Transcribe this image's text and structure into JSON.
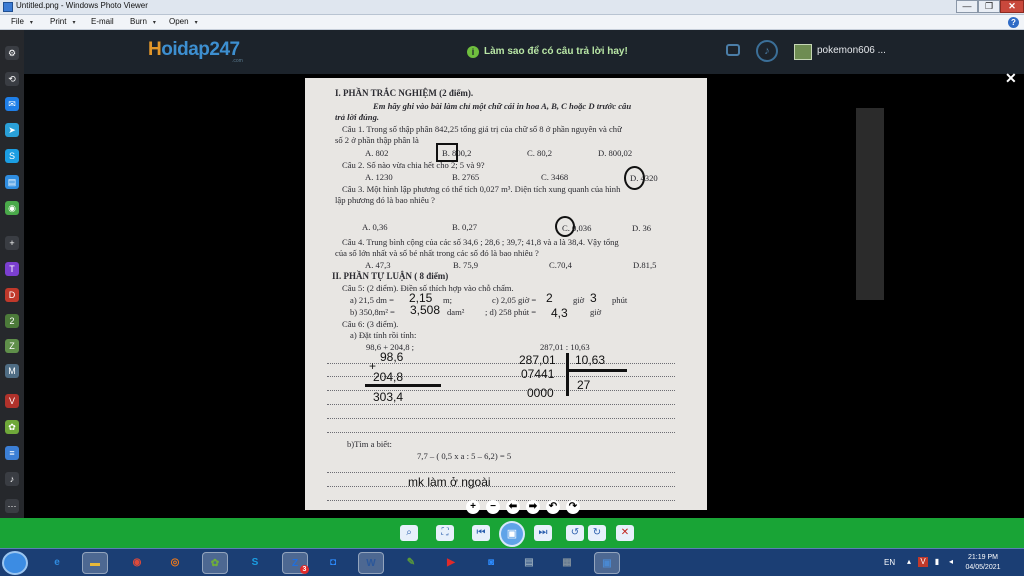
{
  "window": {
    "title": "Untitled.png - Windows Photo Viewer",
    "minimize": "—",
    "maximize": "❐",
    "close": "✕"
  },
  "menu": {
    "items": [
      {
        "label": "File",
        "arrow": "▾"
      },
      {
        "label": "Print",
        "arrow": "▾"
      },
      {
        "label": "E-mail",
        "arrow": ""
      },
      {
        "label": "Burn",
        "arrow": "▾"
      },
      {
        "label": "Open",
        "arrow": "▾"
      }
    ],
    "help": "?"
  },
  "site": {
    "logo_h": "H",
    "logo_rest": "oidap247",
    "logo_sub": ".com",
    "howto": "Làm sao để có câu trả lời hay!",
    "username": "pokemon606 ...",
    "close_overlay": "✕"
  },
  "sidebar": {
    "icons": [
      {
        "name": "settings",
        "glyph": "⚙",
        "color": "#3a3d43"
      },
      {
        "name": "history",
        "glyph": "⟲",
        "color": "#3a3d43"
      },
      {
        "name": "messenger",
        "glyph": "✉",
        "color": "#1f7fe8"
      },
      {
        "name": "telegram",
        "glyph": "➤",
        "color": "#2aa0d8"
      },
      {
        "name": "skype",
        "glyph": "S",
        "color": "#1b9ee3"
      },
      {
        "name": "chat",
        "glyph": "▤",
        "color": "#2f8de0"
      },
      {
        "name": "games",
        "glyph": "◉",
        "color": "#4aa94a"
      },
      {
        "name": "add",
        "glyph": "+",
        "color": "#3a3d43"
      },
      {
        "name": "twitch",
        "glyph": "T",
        "color": "#7b3fd0"
      },
      {
        "name": "d-app",
        "glyph": "D",
        "color": "#c0392b"
      },
      {
        "name": "two",
        "glyph": "2",
        "color": "#4c7a3a"
      },
      {
        "name": "z-app",
        "glyph": "Z",
        "color": "#5f8f4a"
      },
      {
        "name": "m-app",
        "glyph": "M",
        "color": "#4f6d84"
      },
      {
        "name": "vnexpress",
        "glyph": "V",
        "color": "#b0322b"
      },
      {
        "name": "leaf",
        "glyph": "✿",
        "color": "#6fa83a"
      },
      {
        "name": "news",
        "glyph": "≡",
        "color": "#3c7fd5"
      },
      {
        "name": "bell",
        "glyph": "♪",
        "color": "#3a3d43"
      },
      {
        "name": "more",
        "glyph": "⋯",
        "color": "#3a3d43"
      }
    ]
  },
  "photo": {
    "section1_title": "I. PHẦN TRẮC NGHIỆM (2 điểm).",
    "instruction_1": "Em hãy ghi vào bài làm chỉ một chữ cái in hoa A, B, C hoặc D trước câu",
    "instruction_2": "trả lời đúng.",
    "q1_1": "Câu 1. Trong số thập phân 842,25 tổng giá trị của chữ số 8 ở phần nguyên và chữ",
    "q1_2": "số 2 ở phần thập phân là",
    "q1_a": "A. 802",
    "q1_b": "B. 800,2",
    "q1_c": "C.  80,2",
    "q1_d": "D. 800,02",
    "q2": "Câu 2. Số nào vừa chia hết cho 2; 5 và 9?",
    "q2_a": "A. 1230",
    "q2_b": "B. 2765",
    "q2_c": "C. 3468",
    "q2_d": "D. 4320",
    "q3_1": "Câu 3. Một hình lập phương có thể tích 0,027 m³. Diện tích xung quanh của hình",
    "q3_2": "lập phương đó là bao nhiêu ?",
    "q3_a": "A.   0,36",
    "q3_b": "B.     0,27",
    "q3_c": "C. 0,036",
    "q3_d": "D. 36",
    "q4_1": "Câu 4. Trung bình cộng của các số 34,6 ; 28,6 ; 39,7; 41,8 và a là 38,4. Vậy tổng",
    "q4_2": "của số lớn nhất và số bé nhất trong các số đó  là bao nhiêu ?",
    "q4_a": "A. 47,3",
    "q4_b": "B. 75,9",
    "q4_c": "C.70,4",
    "q4_d": "D.81,5",
    "section2_title": "II. PHẦN TỰ LUẬN ( 8 điểm)",
    "q5": "Câu 5: (2 điểm).  Điền số thích hợp vào chỗ chấm.",
    "q5_a": "a) 21,5 dm =",
    "q5_a_unit": "m;",
    "q5_c": "c) 2,05 giờ =",
    "q5_c_unit": "giờ",
    "q5_c_unit2": "phút",
    "q5_b": "b) 350,8m² =",
    "q5_b_unit": "dam²",
    "q5_d": "; d) 258 phút =",
    "q5_d_unit": "giờ",
    "q6": "Câu 6: (3 điểm).",
    "q6_a": "a) Đặt tính rồi tính:",
    "q6_a1": "98,6 + 204,8  ;",
    "q6_a2": "287,01 : 10,63",
    "q6_b": "b)Tìm a biết:",
    "q6_b_expr": "7,7 – ( 0,5 x a : 5 – 6,2) = 5"
  },
  "handwriting": {
    "q5a": "2,15",
    "q5c1": "2",
    "q5c2": "3",
    "q5b": "3,508",
    "q5d": "4,3",
    "add_top": "98,6",
    "add_plus": "+",
    "add_bottom": "204,8",
    "add_result": "303,4",
    "div_dividend": "287,01",
    "div_divisor": "10,63",
    "div_step": "07441",
    "div_quotient": "27",
    "div_remainder": "0000",
    "note": "mk làm ở ngoài"
  },
  "zoom_tools": [
    "+",
    "−",
    "⬅",
    "➡",
    "↶",
    "↷"
  ],
  "viewer_toolbar": {
    "zoom": "⌕",
    "actual_size": "⛶",
    "previous": "⏮",
    "slideshow": "▣",
    "next": "⏭",
    "rotate_ccw": "↺",
    "rotate_cw": "↻",
    "delete": "✕"
  },
  "taskbar": {
    "apps": [
      {
        "name": "ie",
        "glyph": "e",
        "color": "#2f8be0",
        "active": false
      },
      {
        "name": "explorer",
        "glyph": "▬",
        "color": "#e8b93a",
        "active": true
      },
      {
        "name": "chrome",
        "glyph": "◉",
        "color": "#e04a3a",
        "active": false
      },
      {
        "name": "firefox",
        "glyph": "◎",
        "color": "#ef7a1a",
        "active": false
      },
      {
        "name": "leaf",
        "glyph": "✿",
        "color": "#6fae3a",
        "active": true
      },
      {
        "name": "skype",
        "glyph": "S",
        "color": "#1b9ee3",
        "active": false
      },
      {
        "name": "zalo",
        "glyph": "Z",
        "color": "#1e6fe0",
        "active": true
      },
      {
        "name": "zoom",
        "glyph": "◘",
        "color": "#2d8cff",
        "active": false
      },
      {
        "name": "word",
        "glyph": "W",
        "color": "#2b579a",
        "active": true
      },
      {
        "name": "paint",
        "glyph": "✎",
        "color": "#5a9a3a",
        "active": false
      },
      {
        "name": "youtube",
        "glyph": "▶",
        "color": "#e02a2a",
        "active": false
      },
      {
        "name": "zoom2",
        "glyph": "◙",
        "color": "#2d8cff",
        "active": false
      },
      {
        "name": "notes",
        "glyph": "▤",
        "color": "#8aa0b5",
        "active": false
      },
      {
        "name": "calc",
        "glyph": "▦",
        "color": "#7d8c9a",
        "active": false
      },
      {
        "name": "photo-viewer",
        "glyph": "▣",
        "color": "#4a88d0",
        "active": true
      }
    ],
    "zalo_badge": "3",
    "lang": "EN",
    "time": "21:19 PM",
    "date": "04/05/2021"
  }
}
